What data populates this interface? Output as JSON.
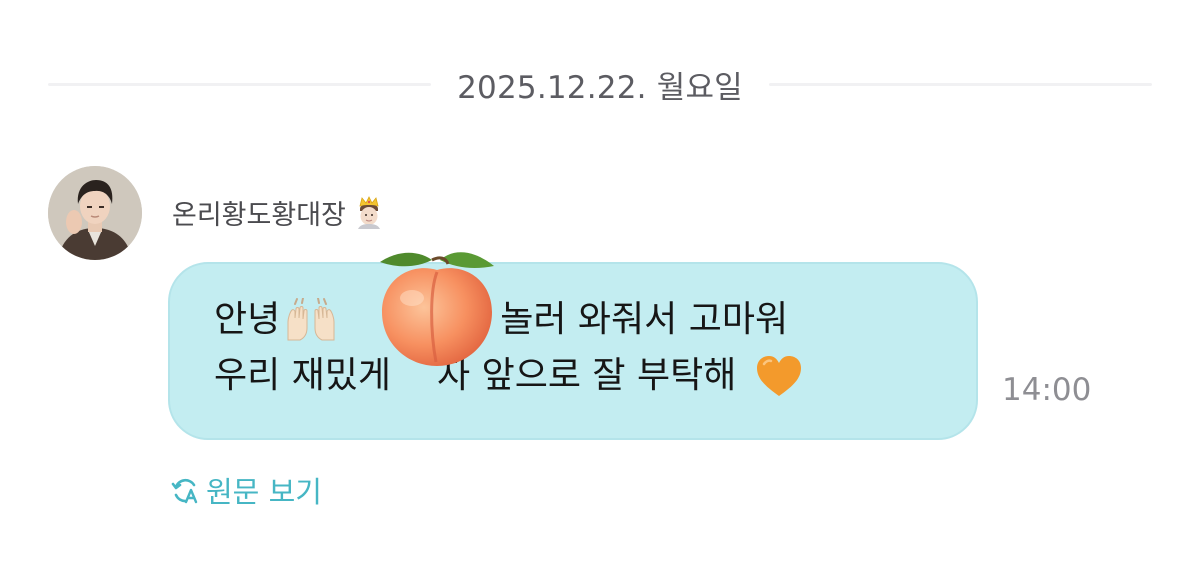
{
  "date_separator": {
    "text": "2025.12.22. 월요일"
  },
  "message": {
    "sender_name": "온리황도황대장",
    "sender_badge_icon": "prince-emoji-icon",
    "line1_start": "안녕",
    "line1_end": "놀러 와줘서 고마워",
    "line2_start": "우리 재밌게",
    "line2_end": "자 앞으로 잘 부탁해",
    "line1_icon": "raised-hands-emoji-icon",
    "line2_icon": "orange-heart-emoji-icon",
    "sticker_icon": "peach-emoji-icon",
    "time": "14:00"
  },
  "view_original": {
    "label": "원문 보기",
    "icon": "translate-refresh-icon"
  },
  "colors": {
    "bubble": "#c3edf1",
    "accent": "#46b6c4",
    "timestamp": "#8e8e93"
  }
}
